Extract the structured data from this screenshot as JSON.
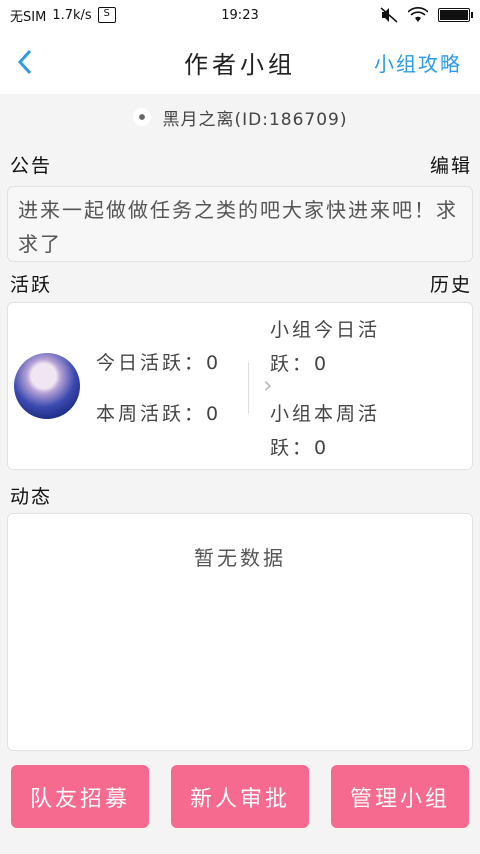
{
  "status_bar": {
    "carrier": "无SIM",
    "speed": "1.7k/s",
    "time": "19:23",
    "icons": [
      "sim-icon",
      "mute-icon",
      "wifi-icon",
      "battery-charging-icon"
    ]
  },
  "header": {
    "back_icon": "chevron-left-icon",
    "title": "作者小组",
    "strategy_label": "小组攻略"
  },
  "owner": {
    "name": "黑月之离(ID:186709)"
  },
  "notice": {
    "label": "公告",
    "edit_label": "编辑",
    "text": "进来一起做做任务之类的吧大家快进来吧！求求了"
  },
  "activity": {
    "label": "活跃",
    "history_label": "历史",
    "today_personal": "今日活跃：0",
    "week_personal": "本周活跃：0",
    "today_group": "小组今日活跃：0",
    "week_group": "小组本周活跃：0"
  },
  "dynamic": {
    "label": "动态",
    "empty_text": "暂无数据"
  },
  "buttons": {
    "recruit": "队友招募",
    "approve": "新人审批",
    "manage": "管理小组"
  },
  "colors": {
    "accent_blue": "#2d9be6",
    "button_pink": "#f76a8f"
  }
}
